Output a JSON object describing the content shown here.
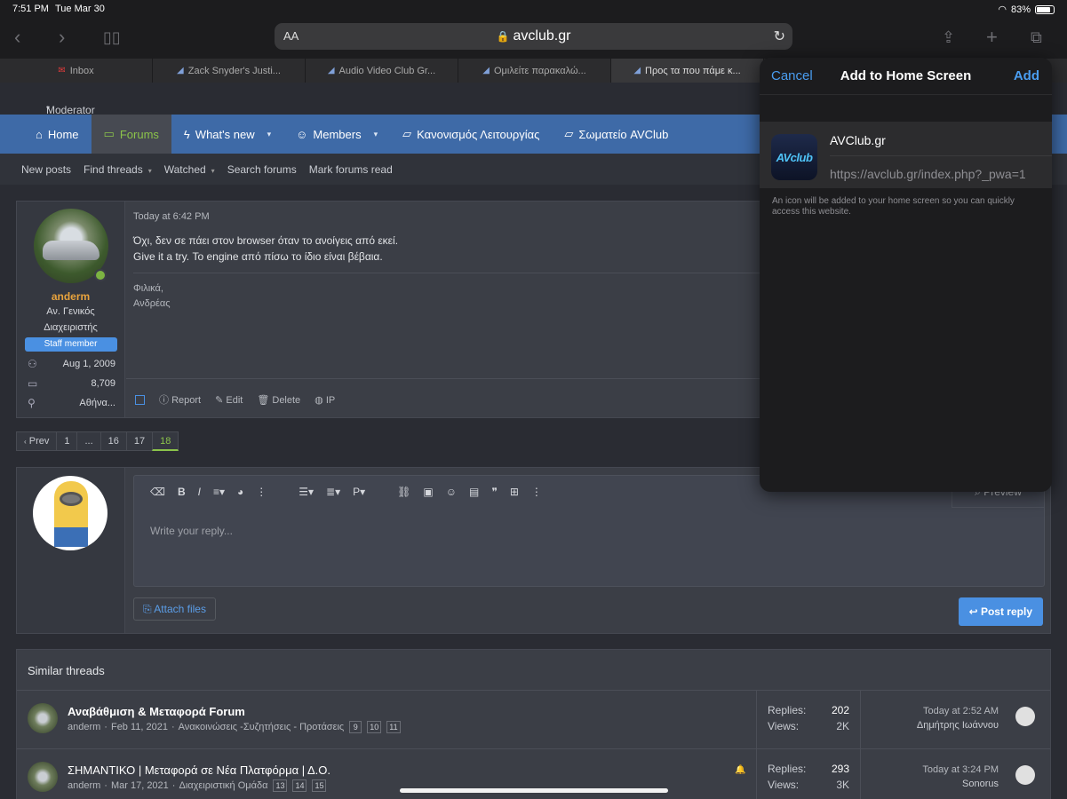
{
  "status": {
    "time": "7:51 PM",
    "date": "Tue Mar 30",
    "battery": "83%"
  },
  "browser": {
    "url": "avclub.gr",
    "text_size": "AA",
    "tabs": [
      {
        "label": "Inbox",
        "icon": "gmail-icon"
      },
      {
        "label": "Zack Snyder's Justi...",
        "icon": "avclub-icon"
      },
      {
        "label": "Audio Video Club Gr...",
        "icon": "avclub-icon"
      },
      {
        "label": "Ομιλείτε παρακαλώ...",
        "icon": "avclub-icon"
      },
      {
        "label": "Προς τα που πάμε κ...",
        "icon": "avclub-icon"
      }
    ]
  },
  "forum": {
    "moderator_label": "Moderator",
    "nav": [
      "Home",
      "Forums",
      "What's new",
      "Members",
      "Κανονισμός Λειτουργίας",
      "Σωματείο AVClub"
    ],
    "subnav": [
      "New posts",
      "Find threads",
      "Watched",
      "Search forums",
      "Mark forums read"
    ],
    "post": {
      "user": "anderm",
      "user_title_1": "Αν. Γενικός",
      "user_title_2": "Διαχειριστής",
      "badge": "Staff member",
      "joined": "Aug 1, 2009",
      "messages": "8,709",
      "location": "Αθήνα...",
      "date": "Today at 6:42 PM",
      "line1": "Όχι, δεν σε πάει στον browser όταν το ανοίγεις από εκεί.",
      "line2": "Give it a try. Το engine από πίσω το ίδιο είναι βέβαια.",
      "sig1": "Φιλικά,",
      "sig2": "Ανδρέας",
      "actions": [
        "Report",
        "Edit",
        "Delete",
        "IP"
      ]
    },
    "pager": [
      "Prev",
      "1",
      "...",
      "16",
      "17",
      "18"
    ],
    "reply": {
      "placeholder": "Write your reply...",
      "preview": "Preview",
      "attach": "Attach files",
      "submit": "Post reply"
    },
    "similar": {
      "heading": "Similar threads",
      "threads": [
        {
          "title": "Αναβάθμιση & Μεταφορά Forum",
          "author": "anderm",
          "date": "Feb 11, 2021",
          "forum": "Ανακοινώσεις -Συζητήσεις - Προτάσεις",
          "pages": [
            "9",
            "10",
            "11"
          ],
          "replies": "202",
          "views": "2K",
          "last_date": "Today at 2:52 AM",
          "last_user": "Δημήτρης Ιωάννου"
        },
        {
          "title": "ΣΗΜΑΝΤΙΚΟ | Μεταφορά σε Νέα Πλατφόρμα | Δ.Ο.",
          "author": "anderm",
          "date": "Mar 17, 2021",
          "forum": "Διαχειριστική Ομάδα",
          "pages": [
            "13",
            "14",
            "15"
          ],
          "replies": "293",
          "views": "3K",
          "last_date": "Today at 3:24 PM",
          "last_user": "Sonorus"
        }
      ],
      "replies_label": "Replies:",
      "views_label": "Views:"
    }
  },
  "sheet": {
    "cancel": "Cancel",
    "title": "Add to Home Screen",
    "add": "Add",
    "app_name": "AVClub.gr",
    "app_url": "https://avclub.gr/index.php?_pwa=1",
    "icon_text": "AVclub",
    "note": "An icon will be added to your home screen so you can quickly access this website."
  }
}
